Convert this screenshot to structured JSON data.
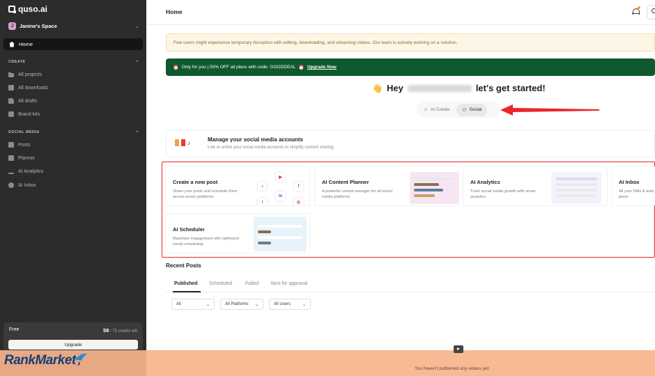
{
  "brand": {
    "name": "quso.ai"
  },
  "workspace": {
    "initial": "J",
    "name": "Janine's Space"
  },
  "sidebar": {
    "home_label": "Home",
    "create_heading": "CREATE",
    "create_items": [
      {
        "label": "All projects",
        "icon": "folder-icon"
      },
      {
        "label": "All downloads",
        "icon": "download-icon"
      },
      {
        "label": "All drafts",
        "icon": "draft-icon"
      },
      {
        "label": "Brand kits",
        "icon": "brand-kit-icon"
      }
    ],
    "social_heading": "SOCIAL MEDIA",
    "social_items": [
      {
        "label": "Posts",
        "icon": "posts-icon"
      },
      {
        "label": "Planner",
        "icon": "planner-icon"
      },
      {
        "label": "AI Analytics",
        "icon": "analytics-icon"
      },
      {
        "label": "AI Inbox",
        "icon": "inbox-icon"
      }
    ],
    "plan": {
      "name": "Free",
      "credits_used": "58",
      "credits_total": "/ 75 credits left",
      "upgrade_label": "Upgrade"
    }
  },
  "header": {
    "title": "Home"
  },
  "notice": "Few users might experience temporary disruption with editing, downloading, and streaming videos. Our team is actively working on a solution.",
  "promo": {
    "text": "Only for you | 50% OFF all plans with code: GOODDEAL",
    "link": "Upgrade Now"
  },
  "greeting": {
    "prefix": "Hey",
    "suffix": "let's get started!"
  },
  "mode_toggle": {
    "options": [
      "AI Create",
      "Social"
    ],
    "selected": "Social"
  },
  "manage_accounts": {
    "title": "Manage your social media accounts",
    "subtitle": "Link or unlink your social media accounts to simplify content sharing."
  },
  "cards": [
    {
      "title": "Create a new post",
      "desc": "Share your posts and schedule them across seven platforms"
    },
    {
      "title": "AI Content Planner",
      "desc": "A powerful central manager for all social media platforms"
    },
    {
      "title": "AI Analytics",
      "desc": "Track social media growth with smart analytics"
    },
    {
      "title": "AI Inbox",
      "desc": "All your DMs & auto place"
    },
    {
      "title": "AI Scheduler",
      "desc": "Maximize engagement with optimized social scheduling"
    }
  ],
  "recent_posts": {
    "title": "Recent Posts",
    "tabs": [
      "Published",
      "Scheduled",
      "Failed",
      "Sent for approval"
    ],
    "active_tab": "Published",
    "filters": [
      "All",
      "All Platforms",
      "All Users"
    ],
    "empty_text": "You haven't published any videos yet"
  },
  "watermark": {
    "text": "RankMarket"
  },
  "colors": {
    "promo_green": "#10592f",
    "highlight_red": "#e8262c",
    "notice_bg": "#fdf6e7",
    "sidebar_bg": "#2c2c2c"
  }
}
